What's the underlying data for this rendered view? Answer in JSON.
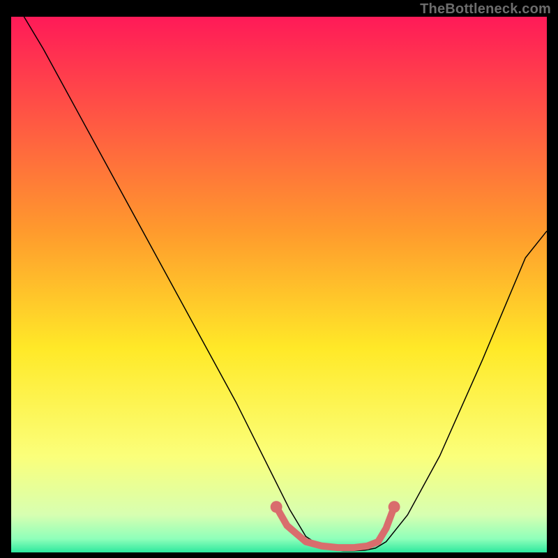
{
  "watermark": "TheBottleneck.com",
  "chart_data": {
    "type": "line",
    "title": "",
    "xlabel": "",
    "ylabel": "",
    "xlim": [
      0,
      100
    ],
    "ylim": [
      0,
      100
    ],
    "background_gradient": {
      "stops": [
        {
          "offset": 0.0,
          "color": "#ff1a58"
        },
        {
          "offset": 0.4,
          "color": "#ff9a2d"
        },
        {
          "offset": 0.62,
          "color": "#ffe928"
        },
        {
          "offset": 0.82,
          "color": "#fbff7a"
        },
        {
          "offset": 0.93,
          "color": "#d7ffb1"
        },
        {
          "offset": 0.975,
          "color": "#8effba"
        },
        {
          "offset": 1.0,
          "color": "#2de89e"
        }
      ]
    },
    "series": [
      {
        "name": "bottleneck-curve",
        "color": "#000000",
        "x": [
          0,
          6,
          12,
          18,
          24,
          30,
          36,
          42,
          48,
          52,
          55,
          58,
          60,
          62,
          64,
          66,
          68,
          70,
          74,
          80,
          88,
          96,
          100
        ],
        "y": [
          104,
          94,
          83,
          72,
          61,
          50,
          39,
          28,
          16,
          8,
          3,
          1,
          0.5,
          0.3,
          0.3,
          0.4,
          0.8,
          2,
          7,
          18,
          36,
          55,
          60
        ]
      }
    ],
    "highlight": {
      "name": "optimal-range",
      "color": "#d96d6d",
      "points": [
        {
          "x": 49.5,
          "y": 8.5
        },
        {
          "x": 51.5,
          "y": 5.0
        },
        {
          "x": 55.0,
          "y": 2.0
        },
        {
          "x": 58.0,
          "y": 1.2
        },
        {
          "x": 61.0,
          "y": 0.9
        },
        {
          "x": 64.0,
          "y": 0.9
        },
        {
          "x": 66.5,
          "y": 1.2
        },
        {
          "x": 68.5,
          "y": 2.0
        },
        {
          "x": 70.0,
          "y": 4.5
        },
        {
          "x": 71.5,
          "y": 8.5
        }
      ]
    }
  }
}
